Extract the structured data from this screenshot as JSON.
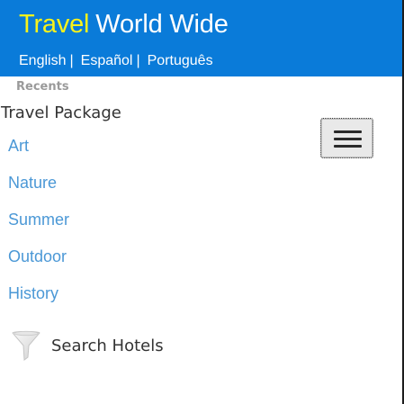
{
  "header": {
    "brand_word1": "Travel",
    "brand_word2": "World Wide",
    "colors": {
      "background": "#0a7bd9",
      "brand_accent": "#f8f21b",
      "text": "#ffffff"
    }
  },
  "languages": {
    "items": [
      {
        "label": "English"
      },
      {
        "label": "Español"
      },
      {
        "label": "Português"
      }
    ],
    "separator": "|"
  },
  "sidebar": {
    "recents_label": "Recents",
    "section_title": "Travel Package",
    "categories": [
      {
        "label": "Art"
      },
      {
        "label": "Nature"
      },
      {
        "label": "Summer"
      },
      {
        "label": "Outdoor"
      },
      {
        "label": "History"
      }
    ],
    "link_color": "#4b98d6"
  },
  "menu_button": {
    "icon": "hamburger-menu-icon"
  },
  "search": {
    "label": "Search Hotels",
    "icon": "funnel-filter-icon"
  }
}
